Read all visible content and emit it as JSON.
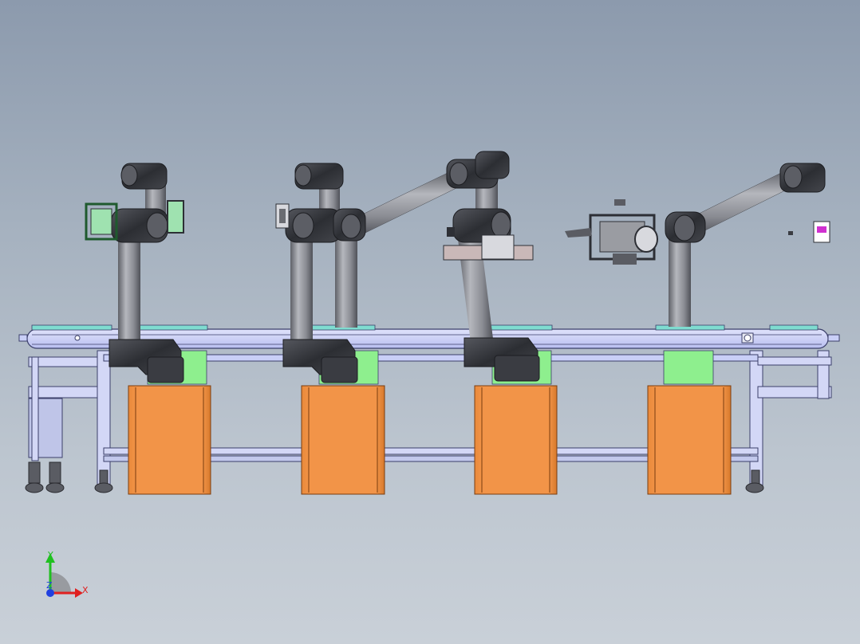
{
  "triad": {
    "x_label": "X",
    "y_label": "Y",
    "z_label": "Z"
  },
  "colors": {
    "frame": "#c9cff7",
    "frame_edge": "#3b3f6a",
    "cabinet": "#f0913f",
    "cabinet_edge": "#7a3d10",
    "plate": "#8eef8e",
    "arm_tube": "#8d8f96",
    "joint": "#3a3c42",
    "axis_x": "#e02020",
    "axis_y": "#20c020",
    "axis_z": "#2040e0"
  }
}
